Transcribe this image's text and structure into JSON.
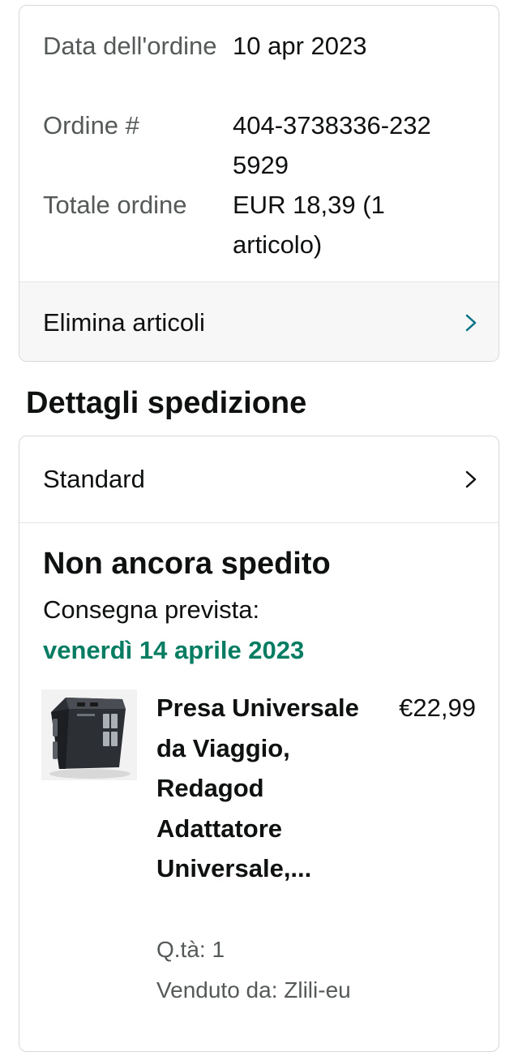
{
  "order_summary": {
    "rows": [
      {
        "label": "Data dell'ordine",
        "value": "10 apr 2023"
      },
      {
        "label": "Ordine #",
        "value": "404-3738336-2325929"
      },
      {
        "label": "Totale ordine",
        "value": "EUR 18,39 (1 articolo)"
      }
    ],
    "delete_items_label": "Elimina articoli",
    "delete_chevron_icon": "chevron-right-icon",
    "delete_chevron_color": "#007185"
  },
  "shipping": {
    "section_title": "Dettagli spedizione",
    "method_label": "Standard",
    "method_chevron_icon": "chevron-right-icon",
    "status_title": "Non ancora spedito",
    "delivery_label": "Consegna prevista:",
    "delivery_date": "venerdì 14 aprile 2023",
    "delivery_date_color": "#067d62",
    "item": {
      "image_icon": "travel-adapter-image",
      "title": "Presa Universale da Viaggio, Redagod Adattatore Universale,...",
      "price": "€22,99",
      "quantity": "Q.tà: 1",
      "seller": "Venduto da: Zlili-eu"
    }
  }
}
